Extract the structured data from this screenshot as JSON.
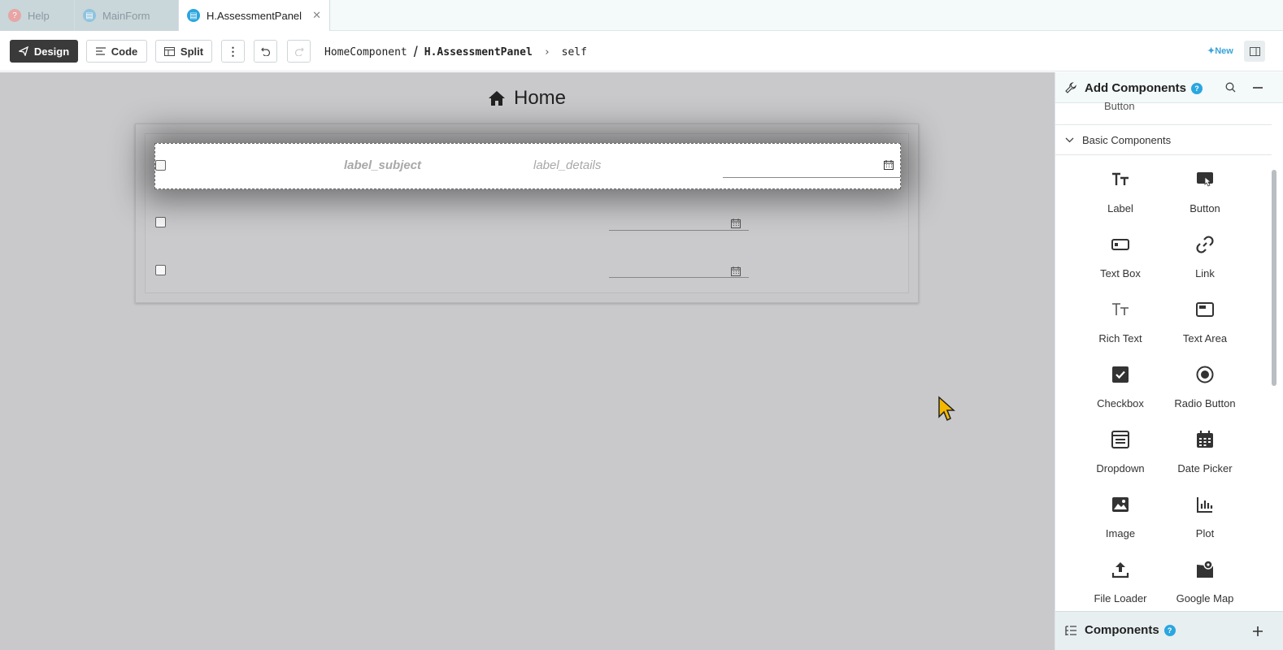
{
  "tabs": [
    {
      "label": "Help",
      "icon": "help-icon"
    },
    {
      "label": "MainForm",
      "icon": "document-icon"
    },
    {
      "label": "H.AssessmentPanel",
      "icon": "document-icon",
      "active": true
    }
  ],
  "toolbar": {
    "design_label": "Design",
    "code_label": "Code",
    "split_label": "Split",
    "breadcrumb": [
      "HomeComponent",
      "/",
      "H.AssessmentPanel"
    ],
    "self_label": "self",
    "new_label": "New"
  },
  "canvas": {
    "title": "Home",
    "row_labels": {
      "subject": "label_subject",
      "details": "label_details"
    }
  },
  "sidebar": {
    "title": "Add Components",
    "cut_item": "Button",
    "section": "Basic Components",
    "items": [
      {
        "label": "Label",
        "icon": "label-tt-icon"
      },
      {
        "label": "Button",
        "icon": "button-pointer-icon"
      },
      {
        "label": "Text Box",
        "icon": "textbox-icon"
      },
      {
        "label": "Link",
        "icon": "link-icon"
      },
      {
        "label": "Rich Text",
        "icon": "rich-text-icon"
      },
      {
        "label": "Text Area",
        "icon": "text-area-icon"
      },
      {
        "label": "Checkbox",
        "icon": "checkbox-icon"
      },
      {
        "label": "Radio Button",
        "icon": "radio-button-icon"
      },
      {
        "label": "Dropdown",
        "icon": "dropdown-icon"
      },
      {
        "label": "Date Picker",
        "icon": "calendar-icon"
      },
      {
        "label": "Image",
        "icon": "image-icon"
      },
      {
        "label": "Plot",
        "icon": "bar-chart-icon"
      },
      {
        "label": "File Loader",
        "icon": "upload-icon"
      },
      {
        "label": "Google Map",
        "icon": "map-pin-icon"
      }
    ],
    "footer": "Components"
  },
  "colors": {
    "accent": "#2aa6e0",
    "dark_button": "#3a3a3a",
    "canvas_bg": "#c9c9cb"
  }
}
